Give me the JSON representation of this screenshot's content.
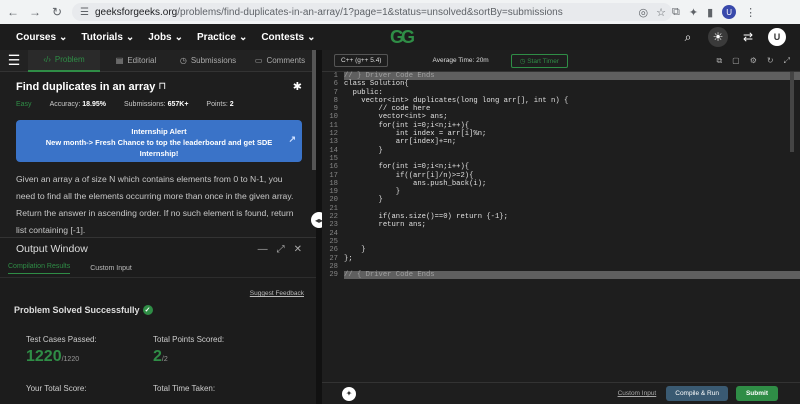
{
  "browser": {
    "url_domain": "geeksforgeeks.org",
    "url_path": "/problems/find-duplicates-in-an-array/1?page=1&status=unsolved&sortBy=submissions",
    "profile_initial": "U"
  },
  "nav": {
    "items": [
      "Courses",
      "Tutorials",
      "Jobs",
      "Practice",
      "Contests"
    ],
    "logo": "GG",
    "avatar": "U"
  },
  "problem": {
    "tabs": [
      "Problem",
      "Editorial",
      "Submissions",
      "Comments"
    ],
    "title": "Find duplicates in an array",
    "difficulty": "Easy",
    "accuracy_label": "Accuracy:",
    "accuracy": "18.95%",
    "submissions_label": "Submissions:",
    "submissions": "657K+",
    "points_label": "Points:",
    "points": "2",
    "alert_title": "Internship Alert",
    "alert_body": "New month-> Fresh Chance to top the leaderboard and get SDE Internship!",
    "description": "Given an array a of size N which contains elements from 0 to N-1, you need to find all the elements occurring more than once in the given array. Return the answer in ascending order. If no such element is found, return list containing [-1]."
  },
  "output": {
    "title": "Output Window",
    "tabs": [
      "Compilation Results",
      "Custom Input"
    ],
    "suggest": "Suggest Feedback",
    "solved": "Problem Solved Successfully",
    "test_label": "Test Cases Passed:",
    "test_value": "1220",
    "test_total": "/1220",
    "points_label": "Total Points Scored:",
    "points_value": "2",
    "points_total": "/2",
    "score_label": "Your Total Score:",
    "time_label": "Total Time Taken:"
  },
  "editor": {
    "language": "C++ (g++ 5.4)",
    "avg_time": "Average Time: 20m",
    "timer": "Start Timer",
    "custom_input": "Custom Input",
    "compile": "Compile & Run",
    "submit": "Submit"
  },
  "code": [
    {
      "n": "1",
      "t": "// } Driver Code Ends",
      "hl": true
    },
    {
      "n": "6",
      "t": "class Solution{"
    },
    {
      "n": "7",
      "t": "  public:"
    },
    {
      "n": "8",
      "t": "    vector<int> duplicates(long long arr[], int n) {"
    },
    {
      "n": "9",
      "t": "        // code here"
    },
    {
      "n": "10",
      "t": "        vector<int> ans;"
    },
    {
      "n": "11",
      "t": "        for(int i=0;i<n;i++){"
    },
    {
      "n": "12",
      "t": "            int index = arr[i]%n;"
    },
    {
      "n": "13",
      "t": "            arr[index]+=n;"
    },
    {
      "n": "14",
      "t": "        }"
    },
    {
      "n": "15",
      "t": ""
    },
    {
      "n": "16",
      "t": "        for(int i=0;i<n;i++){"
    },
    {
      "n": "17",
      "t": "            if((arr[i]/n)>=2){"
    },
    {
      "n": "18",
      "t": "                ans.push_back(i);"
    },
    {
      "n": "19",
      "t": "            }"
    },
    {
      "n": "20",
      "t": "        }"
    },
    {
      "n": "21",
      "t": ""
    },
    {
      "n": "22",
      "t": "        if(ans.size()==0) return {-1};"
    },
    {
      "n": "23",
      "t": "        return ans;"
    },
    {
      "n": "24",
      "t": ""
    },
    {
      "n": "25",
      "t": ""
    },
    {
      "n": "26",
      "t": "    }"
    },
    {
      "n": "27",
      "t": "};"
    },
    {
      "n": "28",
      "t": ""
    },
    {
      "n": "29",
      "t": "// { Driver Code Ends",
      "hl": true
    }
  ]
}
